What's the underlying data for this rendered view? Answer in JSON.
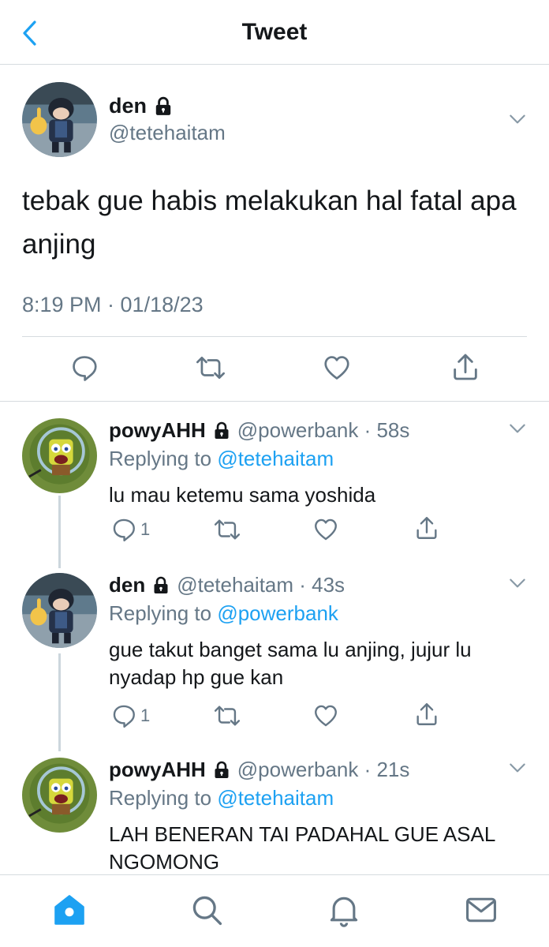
{
  "header": {
    "title": "Tweet"
  },
  "colors": {
    "accent": "#1da1f2",
    "secondary_text": "#657786",
    "divider": "#d6dbdf"
  },
  "main_tweet": {
    "display_name": "den",
    "handle": "@tetehaitam",
    "text": "tebak gue habis melakukan hal fatal apa anjing",
    "timestamp": "8:19 PM · 01/18/23"
  },
  "replies": [
    {
      "display_name": "powyAHH",
      "handle_time": "@powerbank · 58s",
      "replying_prefix": "Replying to ",
      "replying_to": "@tetehaitam",
      "text": "lu mau ketemu sama yoshida",
      "reply_count": "1"
    },
    {
      "display_name": "den",
      "handle_time": "@tetehaitam · 43s",
      "replying_prefix": "Replying to ",
      "replying_to": "@powerbank",
      "text": "gue takut banget sama lu anjing, jujur lu nyadap hp gue kan",
      "reply_count": "1"
    },
    {
      "display_name": "powyAHH",
      "handle_time": "@powerbank · 21s",
      "replying_prefix": "Replying to ",
      "replying_to": "@tetehaitam",
      "text": "LAH BENERAN TAI PADAHAL GUE ASAL NGOMONG"
    }
  ],
  "tabbar": {
    "items": [
      {
        "icon": "home-icon",
        "active": true
      },
      {
        "icon": "search-icon",
        "active": false
      },
      {
        "icon": "bell-icon",
        "active": false
      },
      {
        "icon": "mail-icon",
        "active": false
      }
    ]
  }
}
